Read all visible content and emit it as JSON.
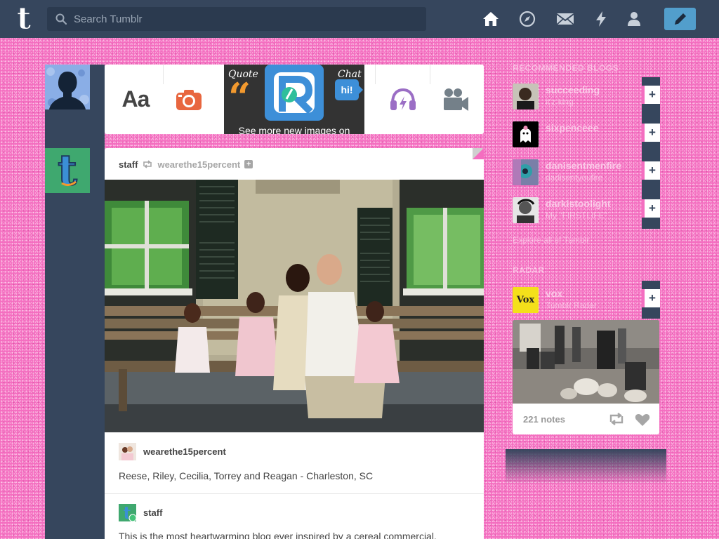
{
  "header": {
    "search_placeholder": "Search Tumblr",
    "nav": [
      "home-icon",
      "explore-icon",
      "messages-icon",
      "activity-icon",
      "account-icon"
    ],
    "compose": "pencil-icon",
    "logo": "t"
  },
  "post_types": {
    "text_label": "Aa",
    "quote_label": "Quote",
    "chat_label": "Chat",
    "chat_bubble": "hi!",
    "ad_caption": "See more new images on"
  },
  "post": {
    "author": "staff",
    "reblogged_from": "wearethe15percent",
    "source_blog": "wearethe15percent",
    "caption": "Reese, Riley, Cecilia, Torrey and Reagan - Charleston, SC",
    "comment_author": "staff",
    "comment_text": "This is the most heartwarming blog ever inspired by a cereal commercial."
  },
  "sidebar": {
    "recommended_title": "Recommended Blogs",
    "recommended": [
      {
        "name": "succeeding",
        "sub": "it'z king"
      },
      {
        "name": "sixpenceee",
        "sub": ""
      },
      {
        "name": "danisentmenfire",
        "sub": "dadisentyoufire"
      },
      {
        "name": "darkistoolight",
        "sub": "My \"FIRSTLIFE\""
      }
    ],
    "explore_link": "Explore all of Tumblr",
    "radar_title": "Radar",
    "radar_blog": {
      "name": "vox",
      "sub": "Tumblr Radar",
      "logo": "Vox"
    },
    "radar_notes": "221 notes"
  },
  "colors": {
    "nav_bg": "#36465d",
    "page_bg": "#f46ec0",
    "compose_bg": "#529ecc"
  }
}
